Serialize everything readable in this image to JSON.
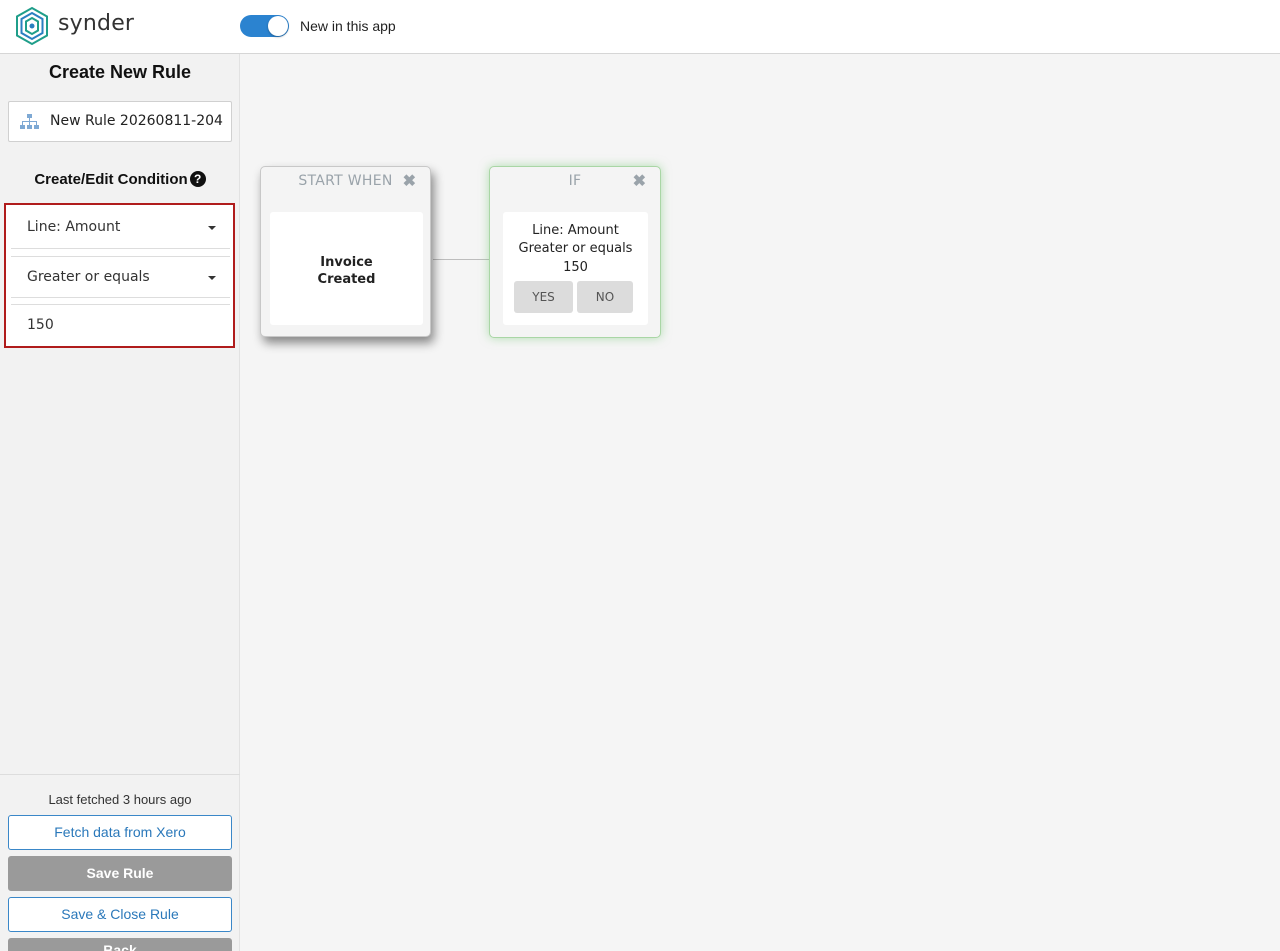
{
  "header": {
    "brand": "synder",
    "toggle_label": "New in this app",
    "toggle_on": true,
    "accent_color": "#2b83d0"
  },
  "sidebar": {
    "title": "Create New Rule",
    "rule_name": "New Rule 20260811-204",
    "rule_icon": "sitemap-icon",
    "condition_title": "Create/Edit Condition",
    "condition": {
      "field": "Line: Amount",
      "operator": "Greater or equals",
      "value": "150"
    },
    "last_fetched": "Last fetched 3 hours ago",
    "buttons": {
      "fetch": "Fetch data from Xero",
      "save": "Save Rule",
      "save_close": "Save & Close Rule",
      "back": "Back"
    }
  },
  "canvas": {
    "start_node": {
      "header": "START WHEN",
      "line1": "Invoice",
      "line2": "Created"
    },
    "if_node": {
      "header": "IF",
      "field": "Line: Amount",
      "operator": "Greater or equals",
      "value": "150",
      "yes": "YES",
      "no": "NO"
    }
  }
}
